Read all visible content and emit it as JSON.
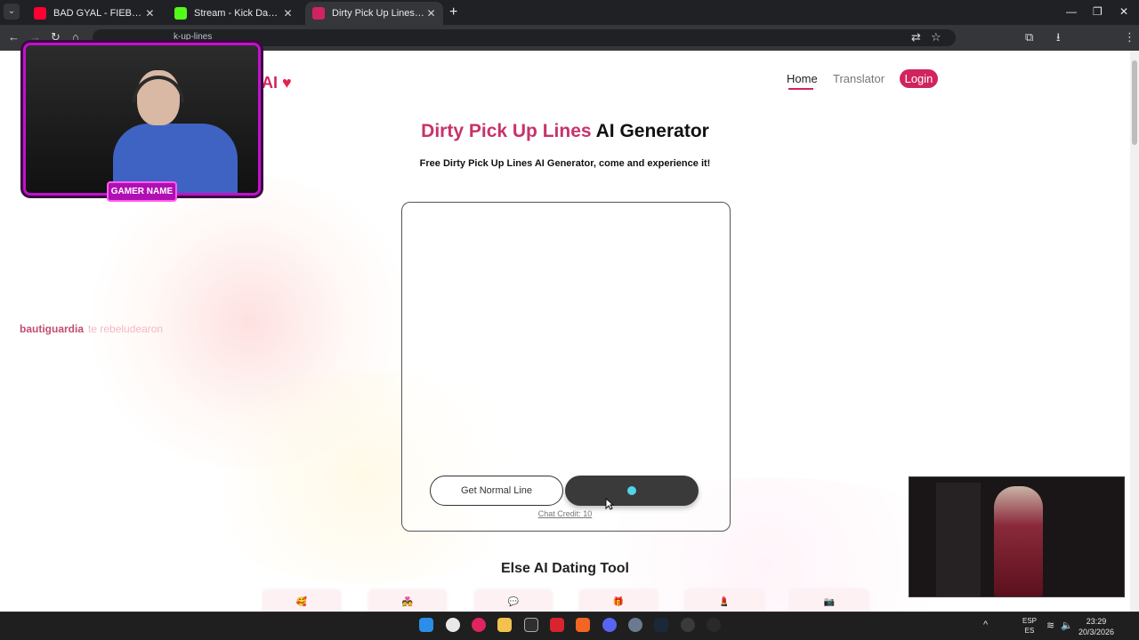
{
  "browser": {
    "tabs": [
      {
        "title": "BAD GYAL - FIEBRE PROD K",
        "close": "✕",
        "favicon_color": "#ff0033"
      },
      {
        "title": "Stream - Kick Dashboard",
        "close": "✕",
        "favicon_color": "#53fc18"
      },
      {
        "title": "Dirty Pick Up Lines AI Generato",
        "close": "✕",
        "favicon_color": "#d1245f"
      }
    ],
    "new_tab": "+",
    "tab_menu": "⌄",
    "window": {
      "minimize": "—",
      "maximize": "❐",
      "close": "✕"
    },
    "url_fragment": "k-up-lines",
    "nav": {
      "back": "←",
      "forward": "→",
      "reload": "↻",
      "home": "⌂"
    },
    "toolbar_icons": {
      "translate": "⇄",
      "star": "☆",
      "extensions": "⧉",
      "download": "⭳",
      "menu": "⋮"
    }
  },
  "site": {
    "logo_fragment": "AI",
    "logo_heart": "♥",
    "nav": {
      "home": "Home",
      "translator": "Translator",
      "login": "Login"
    },
    "heading": {
      "pink": "Dirty Pick Up Lines",
      "dark": "AI Generator"
    },
    "subtitle": "Free Dirty Pick Up Lines AI Generator, come and experience it!",
    "buttons": {
      "normal": "Get Normal Line"
    },
    "chat_credit": "Chat Credit: 10",
    "else_title": "Else AI Dating Tool",
    "tools": [
      "🥰",
      "💑",
      "💬",
      "🎁",
      "💄",
      "📷"
    ]
  },
  "overlay": {
    "gamer_name": "GAMER NAME",
    "chat": {
      "user": "bautiguardia",
      "message": "te rebeludearon"
    }
  },
  "taskbar": {
    "language": {
      "line1": "ESP",
      "line2": "ES"
    },
    "time": "23:29",
    "date": "20/3/2026",
    "tray": {
      "chevron": "^",
      "wifi": "≋",
      "volume": "🔈"
    }
  },
  "colors": {
    "accent": "#d1245f",
    "heading_pink": "#c8326a",
    "dark_button": "#3a3a3a",
    "loading_dot": "#4fd6e8"
  }
}
